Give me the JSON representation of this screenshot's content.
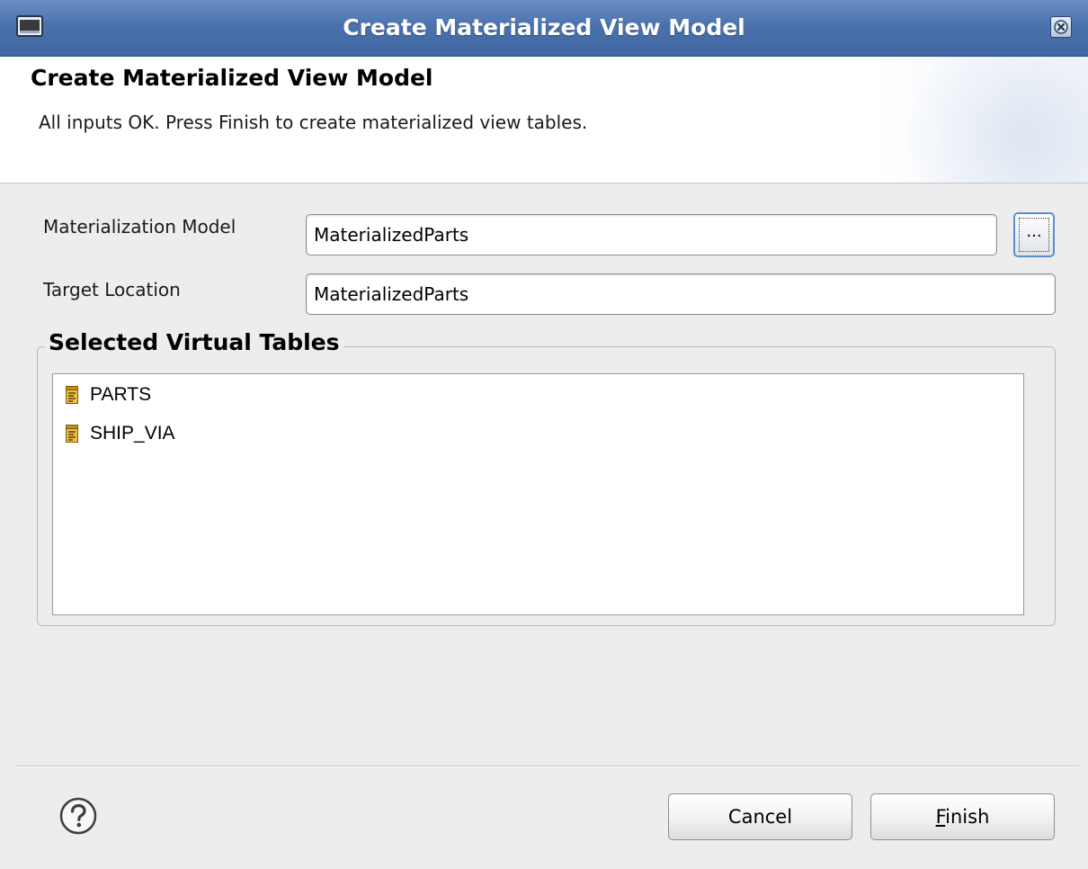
{
  "window": {
    "title": "Create Materialized View Model"
  },
  "banner": {
    "title": "Create Materialized View Model",
    "message": "All inputs OK. Press Finish to create materialized view tables."
  },
  "form": {
    "materialization_model_label": "Materialization Model",
    "materialization_model_value": "MaterializedParts",
    "browse_label": "...",
    "target_location_label": "Target Location",
    "target_location_value": "MaterializedParts"
  },
  "tables_group": {
    "legend": "Selected Virtual Tables",
    "items": [
      {
        "label": "PARTS",
        "icon": "table-icon"
      },
      {
        "label": "SHIP_VIA",
        "icon": "table-icon"
      }
    ]
  },
  "footer": {
    "help_icon": "help-icon",
    "cancel_label": "Cancel",
    "finish_mnemonic": "F",
    "finish_rest": "inish"
  },
  "colors": {
    "titlebar": "#4a72ad",
    "focus_border": "#5b8dd0",
    "table_icon": "#d9a520"
  }
}
